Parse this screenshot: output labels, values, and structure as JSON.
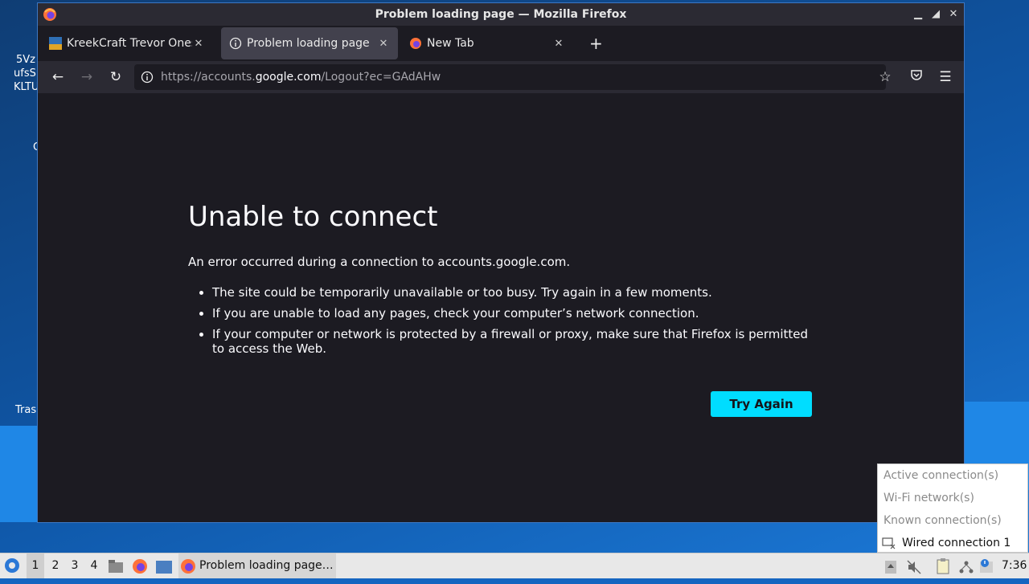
{
  "window": {
    "title": "Problem loading page — Mozilla Firefox",
    "controls": {
      "minimize": "▁",
      "restore": "◢",
      "close": "✕"
    }
  },
  "desktop": {
    "icon_labels": [
      "5Vz",
      "ufsS",
      "KLTU",
      "C",
      "Tras"
    ]
  },
  "tabs": [
    {
      "title": "KreekCraft Trevor Onesie",
      "close": "✕"
    },
    {
      "title": "Problem loading page",
      "close": "✕"
    },
    {
      "title": "New Tab",
      "close": "✕"
    }
  ],
  "new_tab_label": "+",
  "navigation": {
    "back": "←",
    "forward": "→",
    "reload": "↻",
    "url_prefix": "https://accounts.",
    "url_host": "google.com",
    "url_suffix": "/Logout?ec=GAdAHw",
    "bookmark_icon": "☆",
    "pocket_icon": "pocket",
    "menu_icon": "☰"
  },
  "error_page": {
    "heading": "Unable to connect",
    "description": "An error occurred during a connection to accounts.google.com.",
    "reasons": [
      "The site could be temporarily unavailable or too busy. Try again in a few moments.",
      "If you are unable to load any pages, check your computer’s network connection.",
      "If your computer or network is protected by a firewall or proxy, make sure that Firefox is permitted to access the Web."
    ],
    "try_again": "Try Again",
    "accent_color": "#00ddff"
  },
  "network_menu": {
    "items": [
      "Active connection(s)",
      "Wi-Fi network(s)",
      "Known connection(s)"
    ],
    "wired": "Wired connection 1"
  },
  "taskbar": {
    "workspaces": [
      "1",
      "2",
      "3",
      "4"
    ],
    "active_workspace": "1",
    "task_title": "Problem loading page…",
    "clock": "7:36"
  }
}
